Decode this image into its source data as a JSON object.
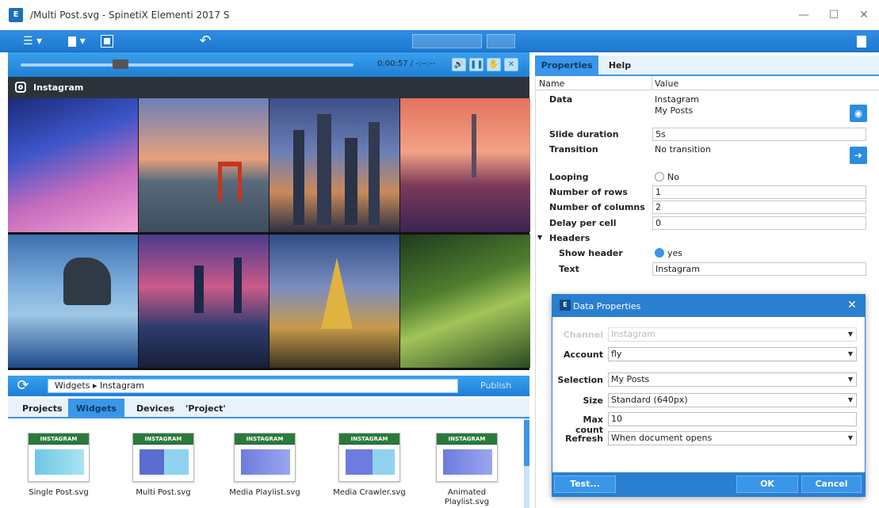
{
  "window": {
    "title": "/Multi Post.svg - SpinetiX Elementi 2017 S",
    "minimize": "—",
    "maximize": "☐",
    "close": "✕"
  },
  "toolbar": {
    "menu_icon": "☰",
    "new_icon": "📄",
    "save_icon": "💾",
    "undo_icon": "↶",
    "side_icon": "▣"
  },
  "player": {
    "timecode": "0:00:57 / -:--:--",
    "progress_fraction": 0.3,
    "buttons": [
      "🔊",
      "❚❚",
      "✋",
      "✕"
    ]
  },
  "stage": {
    "title": "Instagram"
  },
  "path": {
    "value": "Widgets ▸ Instagram",
    "publish": "Publish"
  },
  "tabs": [
    "Projects",
    "Widgets",
    "Devices",
    "'Project'"
  ],
  "widgets": [
    {
      "tag": "INSTAGRAM",
      "label": "Single Post.svg"
    },
    {
      "tag": "INSTAGRAM",
      "label": "Multi Post.svg"
    },
    {
      "tag": "INSTAGRAM",
      "label": "Media Playlist.svg"
    },
    {
      "tag": "INSTAGRAM",
      "label": "Media Crawler.svg"
    },
    {
      "tag": "INSTAGRAM",
      "label": "Animated Playlist.svg"
    }
  ],
  "right_tabs": {
    "properties": "Properties",
    "help": "Help"
  },
  "props": {
    "col_name": "Name",
    "col_value": "Value",
    "data_label": "Data",
    "data_value1": "Instagram",
    "data_value2": "My Posts",
    "slide_duration_label": "Slide duration",
    "slide_duration_value": "5s",
    "transition_label": "Transition",
    "transition_value": "No transition",
    "looping_label": "Looping",
    "looping_value": "No",
    "rows_label": "Number of rows",
    "rows_value": "1",
    "cols_label": "Number of columns",
    "cols_value": "2",
    "delay_label": "Delay per cell",
    "delay_value": "0",
    "headers_label": "Headers",
    "show_header_label": "Show header",
    "show_header_value": "yes",
    "text_label": "Text",
    "text_value": "Instagram"
  },
  "dialog": {
    "title": "Data Properties",
    "close": "✕",
    "channel_label": "Channel",
    "channel_value": "Instagram",
    "account_label": "Account",
    "account_value": "fly",
    "selection_label": "Selection",
    "selection_value": "My Posts",
    "size_label": "Size",
    "size_value": "Standard (640px)",
    "max_count_label": "Max count",
    "max_count_value": "10",
    "refresh_label": "Refresh",
    "refresh_value": "When document opens",
    "test": "Test...",
    "ok": "OK",
    "cancel": "Cancel"
  }
}
